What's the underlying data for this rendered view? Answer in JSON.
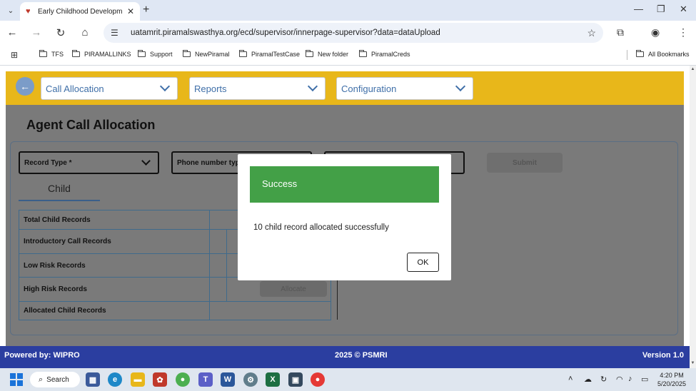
{
  "browser": {
    "tab_title": "Early Childhood Developme",
    "url": "uatamrit.piramalswasthya.org/ecd/supervisor/innerpage-supervisor?data=dataUpload",
    "bookmarks": [
      "TFS",
      "PIRAMALLINKS",
      "Support",
      "NewPiramal",
      "PiramalTestCase",
      "New folder",
      "PiramalCreds"
    ],
    "all_bookmarks": "All Bookmarks"
  },
  "topnav": {
    "menus": [
      "Call Allocation",
      "Reports",
      "Configuration"
    ]
  },
  "page": {
    "title": "Agent Call Allocation",
    "fields": {
      "record_type": "Record Type *",
      "phone_number_type": "Phone number type"
    },
    "submit_label": "Submit",
    "tab_label": "Child",
    "table_rows": [
      "Total Child Records",
      "Introductory Call Records",
      "Low Risk Records",
      "High Risk Records",
      "Allocated Child Records"
    ],
    "allocate_label": "Allocate"
  },
  "footer": {
    "powered_by": "Powered by: WIPRO",
    "copyright": "2025 © PSMRI",
    "version": "Version 1.0"
  },
  "modal": {
    "title": "Success",
    "message": "10 child record allocated successfully",
    "ok_label": "OK"
  },
  "taskbar": {
    "search_label": "Search",
    "time": "4:20 PM",
    "date": "5/20/2025"
  },
  "colors": {
    "header_yellow": "#e8b71a",
    "footer_blue": "#2b3ea0",
    "success_green": "#43a047"
  }
}
